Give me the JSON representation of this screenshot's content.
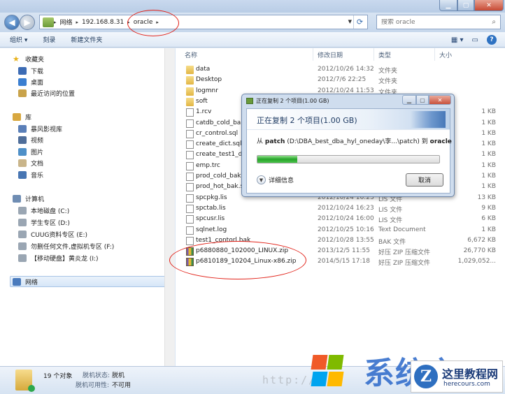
{
  "window": {
    "search_placeholder": "搜索 oracle",
    "breadcrumb": [
      "网络",
      "192.168.8.31",
      "oracle"
    ]
  },
  "toolbar": {
    "organize": "组织 ▾",
    "share": "刻录",
    "new_folder": "新建文件夹"
  },
  "sidebar": {
    "favorites": "收藏夹",
    "downloads": "下载",
    "desktop": "桌面",
    "recent": "最近访问的位置",
    "library": "库",
    "storm": "暴风影视库",
    "video": "视频",
    "pictures": "图片",
    "documents": "文档",
    "music": "音乐",
    "computer": "计算机",
    "drive_c": "本地磁盘 (C:)",
    "drive_d": "学生专区 (D:)",
    "drive_e": "CUUG资料专区 (E:)",
    "drive_f": "勿删任何文件,虚拟机专区 (F:)",
    "drive_i": "【移动硬盘】黄炎龙 (I:)",
    "network": "网络"
  },
  "columns": {
    "name": "名称",
    "date": "修改日期",
    "type": "类型",
    "size": "大小"
  },
  "files": [
    {
      "name": "data",
      "date": "2012/10/26 14:32",
      "type": "文件夹",
      "size": "",
      "kind": "folder"
    },
    {
      "name": "Desktop",
      "date": "2012/7/6 22:25",
      "type": "文件夹",
      "size": "",
      "kind": "folder"
    },
    {
      "name": "logmnr",
      "date": "2012/10/24 11:53",
      "type": "文件夹",
      "size": "",
      "kind": "folder"
    },
    {
      "name": "soft",
      "date": "",
      "type": "",
      "size": "",
      "kind": "folder"
    },
    {
      "name": "1.rcv",
      "date": "",
      "type": "",
      "size": "1 KB",
      "kind": "file"
    },
    {
      "name": "catdb_cold_bak",
      "date": "",
      "type": "",
      "size": "1 KB",
      "kind": "file"
    },
    {
      "name": "cr_control.sql",
      "date": "",
      "type": "",
      "size": "1 KB",
      "kind": "file"
    },
    {
      "name": "create_dict.sql",
      "date": "",
      "type": "",
      "size": "1 KB",
      "kind": "file"
    },
    {
      "name": "create_test1_db",
      "date": "",
      "type": "",
      "size": "1 KB",
      "kind": "file"
    },
    {
      "name": "emp.trc",
      "date": "",
      "type": "",
      "size": "1 KB",
      "kind": "file"
    },
    {
      "name": "prod_cold_bak.",
      "date": "",
      "type": "",
      "size": "1 KB",
      "kind": "file"
    },
    {
      "name": "prod_hot_bak.s",
      "date": "",
      "type": "",
      "size": "1 KB",
      "kind": "file"
    },
    {
      "name": "spcpkg.lis",
      "date": "2012/10/24 16:23",
      "type": "LIS 文件",
      "size": "13 KB",
      "kind": "file"
    },
    {
      "name": "spctab.lis",
      "date": "2012/10/24 16:23",
      "type": "LIS 文件",
      "size": "9 KB",
      "kind": "file"
    },
    {
      "name": "spcusr.lis",
      "date": "2012/10/24 16:00",
      "type": "LIS 文件",
      "size": "6 KB",
      "kind": "file"
    },
    {
      "name": "sqlnet.log",
      "date": "2012/10/25 10:16",
      "type": "Text Document",
      "size": "1 KB",
      "kind": "file"
    },
    {
      "name": "test1_contorl.bak",
      "date": "2012/10/28 13:55",
      "type": "BAK 文件",
      "size": "6,672 KB",
      "kind": "file"
    },
    {
      "name": "p6880880_102000_LINUX.zip",
      "date": "2013/12/5 11:55",
      "type": "好压 ZIP 压缩文件",
      "size": "26,770 KB",
      "kind": "zip"
    },
    {
      "name": "p6810189_10204_Linux-x86.zip",
      "date": "2014/5/15 17:18",
      "type": "好压 ZIP 压缩文件",
      "size": "1,029,052...",
      "kind": "zip"
    }
  ],
  "dialog": {
    "title": "正在复制 2 个项目(1.00 GB)",
    "heading": "正在复制 2 个项目(1.00 GB)",
    "from_label": "从",
    "source_name": "patch",
    "source_path": "(D:\\DBA_best_dba_hyl_oneday\\李...\\patch)",
    "to_label": "到",
    "dest_name": "oracle",
    "progress": 0.22,
    "details": "详细信息",
    "cancel": "取消"
  },
  "status": {
    "count": "19 个对象",
    "offline_status_key": "脱机状态:",
    "offline_status_val": "脱机",
    "offline_avail_key": "脱机可用性:",
    "offline_avail_val": "不可用"
  },
  "watermark": {
    "url": "http://",
    "brand_text": "系统之家",
    "badge_title": "这里教程网",
    "badge_url": "herecours.com"
  },
  "colors": {
    "annotation_red": "#e2231a",
    "progress_green": "#27a42a"
  }
}
